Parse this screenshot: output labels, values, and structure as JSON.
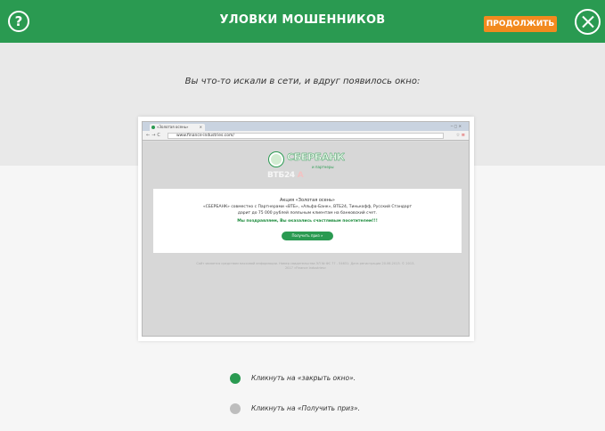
{
  "header": {
    "title": "УЛОВКИ МОШЕННИКОВ",
    "continue_label": "ПРОДОЛЖИТЬ",
    "help_symbol": "?",
    "accent_color": "#2a9a51",
    "continue_color": "#f28a1e"
  },
  "intro": {
    "text": "Вы что-то искали в сети, и вдруг появилось окно:"
  },
  "screenshot": {
    "tab_title": "«Золотая осень»",
    "url": "www.finance-industries.com/",
    "logo_text": "СБЕРБАНК",
    "partners_text": "и партнеры",
    "partner_logos": "ВТБ24",
    "partner_logos_accent": "А",
    "promo_line1": "Акция «Золотая осень»",
    "promo_line2": "«СБЕРБАНК» совместно с Партнерами «ВТБ», «Альфа-Банк», ВТБ24, Тинькофф, Русский Стандарт",
    "promo_line3": "дарит до 75 000 рублей лояльным клиентам на банковский счет.",
    "congrats": "Мы поздравляем, Вы оказались счастливым посетителем!!!",
    "prize_button": "Получить приз »",
    "fineprint": "Сайт является средством массовой информации. Номер свидетельства ЭЛ № ФС 77 - 54631. Дата регистрации 20.06.2013. © 2013-2017 «Finance Industries»"
  },
  "options": [
    {
      "label": "Кликнуть на «закрыть окно».",
      "color": "#2a9a51"
    },
    {
      "label": "Кликнуть на «Получить приз».",
      "color": "#bdbdbd"
    }
  ]
}
